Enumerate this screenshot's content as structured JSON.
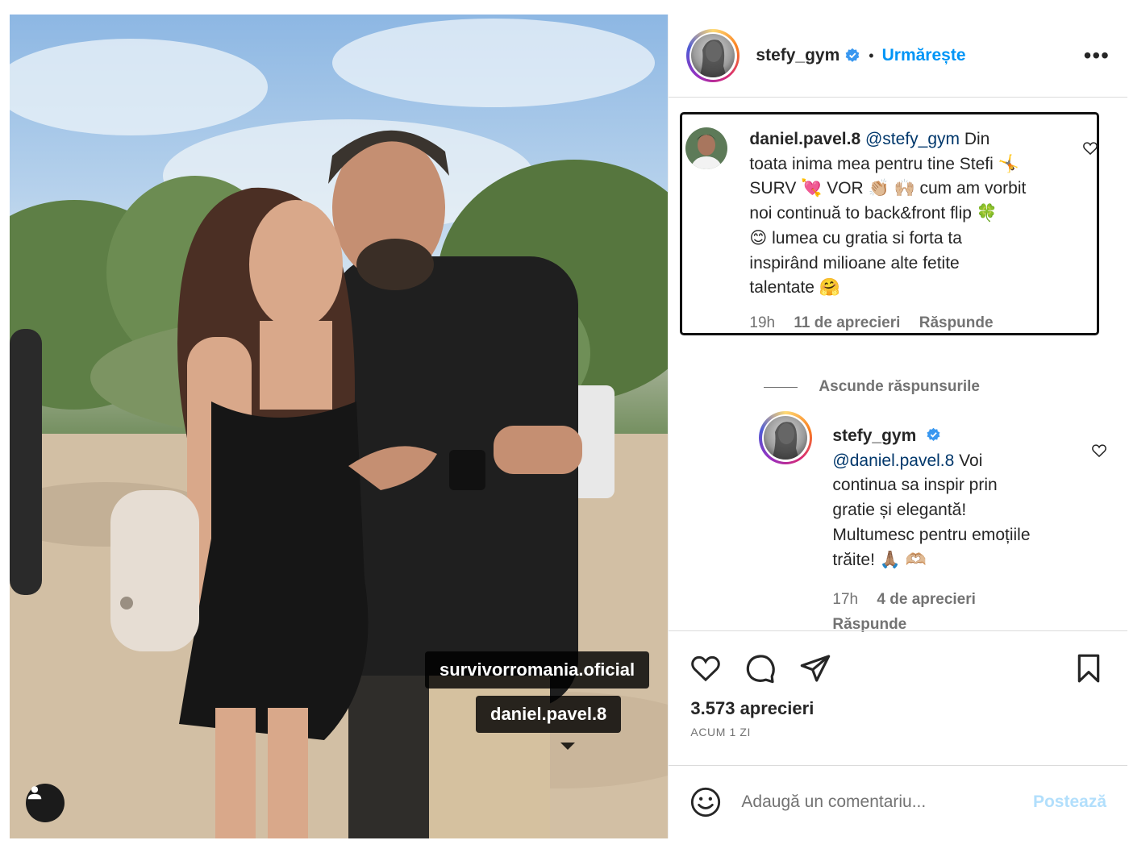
{
  "post": {
    "author": "stefy_gym",
    "follow_label": "Urmărește",
    "separator": "•",
    "more_label": "•••",
    "photo_tags": [
      "survivorromania.oficial",
      "daniel.pavel.8"
    ]
  },
  "comments": [
    {
      "user": "daniel.pavel.8",
      "mention": "@stefy_gym",
      "text_line1": " Din",
      "text_lines": [
        "toata inima mea pentru tine Stefi 🤸",
        "SURV 💘 VOR 👏🏼 🙌🏼 cum am vorbit",
        "noi continuă to back&front flip 🍀",
        "😊 lumea cu gratia si forta ta",
        "inspirând milioane alte fetite",
        "talentate 🤗"
      ],
      "time": "19h",
      "likes": "11 de aprecieri",
      "reply_label": "Răspunde"
    }
  ],
  "hide_replies_label": "Ascunde răspunsurile",
  "reply": {
    "user": "stefy_gym",
    "mention": "@daniel.pavel.8",
    "text_first": " Voi",
    "text_lines": [
      "continua sa inspir prin",
      "gratie și elegantă!",
      "Multumesc pentru emoțiile",
      "trăite! 🙏🏽 🫶🏼"
    ],
    "time": "17h",
    "likes": "4 de aprecieri",
    "reply_label": "Răspunde"
  },
  "stats": {
    "likes": "3.573 aprecieri",
    "time_ago": "ACUM 1 ZI"
  },
  "comment_box": {
    "placeholder": "Adaugă un comentariu...",
    "post_label": "Postează"
  },
  "colors": {
    "accent": "#0095f6",
    "verified": "#3897f0",
    "muted": "#737373",
    "post_disabled": "#b2dffc"
  },
  "icons": [
    "heart-icon",
    "comment-icon",
    "share-icon",
    "bookmark-icon",
    "emoji-icon",
    "verified-icon",
    "user-tag-icon",
    "more-icon"
  ]
}
